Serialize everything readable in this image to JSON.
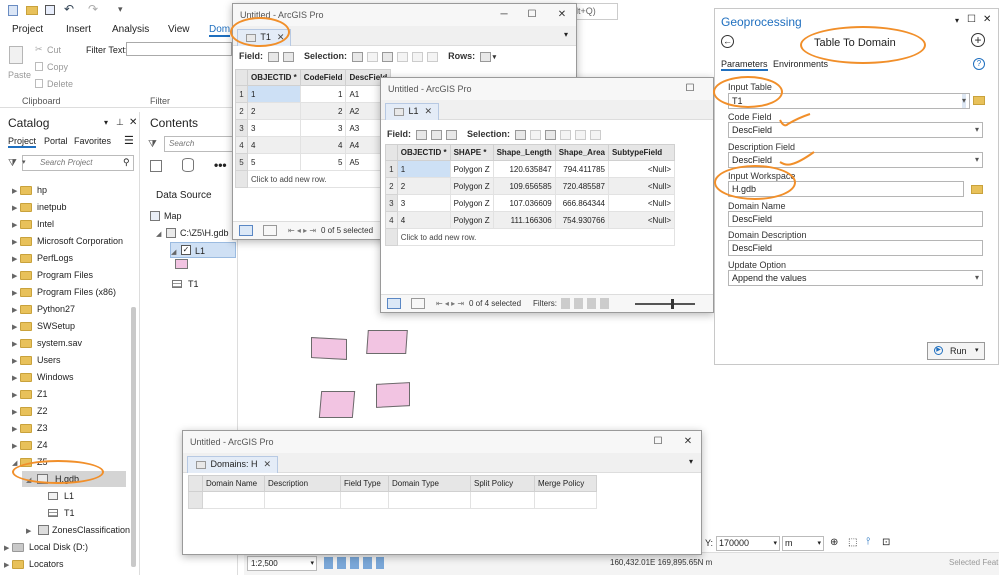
{
  "ribbon": {
    "tabs": [
      "Project",
      "Insert",
      "Analysis",
      "View",
      "Dom"
    ],
    "buttons": {
      "paste": "Paste",
      "cut": "Cut",
      "copy": "Copy",
      "delete": "Delete"
    },
    "filter_text_label": "Filter Text:",
    "groups": {
      "clipboard": "Clipboard",
      "filter": "Filter"
    },
    "search_hint": "Alt+Q)"
  },
  "catalog": {
    "title": "Catalog",
    "tabs": [
      "Project",
      "Portal",
      "Favorites"
    ],
    "search_placeholder": "Search Project",
    "items": [
      "hp",
      "inetpub",
      "Intel",
      "Microsoft Corporation",
      "PerfLogs",
      "Program Files",
      "Program Files (x86)",
      "Python27",
      "SWSetup",
      "system.sav",
      "Users",
      "Windows",
      "Z1",
      "Z2",
      "Z3",
      "Z4",
      "Z5"
    ],
    "gdb": "H.gdb",
    "gdb_children": [
      "L1",
      "T1"
    ],
    "zones": "ZonesClassification",
    "local_disk": "Local Disk (D:)",
    "locators": "Locators"
  },
  "contents": {
    "title": "Contents",
    "search_placeholder": "Search",
    "section": "Data Source",
    "map": "Map",
    "path": "C:\\Z5\\H.gdb",
    "layer": "L1",
    "table": "T1"
  },
  "t1_window": {
    "title": "Untitled - ArcGIS Pro",
    "tab": "T1",
    "field_label": "Field:",
    "selection_label": "Selection:",
    "rows_label": "Rows:",
    "columns": [
      "OBJECTID *",
      "CodeField",
      "DescField"
    ],
    "rows": [
      [
        "1",
        "1",
        "A1"
      ],
      [
        "2",
        "2",
        "A2"
      ],
      [
        "3",
        "3",
        "A3"
      ],
      [
        "4",
        "4",
        "A4"
      ],
      [
        "5",
        "5",
        "A5"
      ]
    ],
    "add_row": "Click to add new row.",
    "status": "0 of 5 selected"
  },
  "l1_window": {
    "title": "Untitled - ArcGIS Pro",
    "tab": "L1",
    "field_label": "Field:",
    "selection_label": "Selection:",
    "columns": [
      "OBJECTID *",
      "SHAPE *",
      "Shape_Length",
      "Shape_Area",
      "SubtypeField"
    ],
    "rows": [
      [
        "1",
        "Polygon Z",
        "120.635847",
        "794.411785",
        "<Null>"
      ],
      [
        "2",
        "Polygon Z",
        "109.656585",
        "720.485587",
        "<Null>"
      ],
      [
        "3",
        "Polygon Z",
        "107.036609",
        "666.864344",
        "<Null>"
      ],
      [
        "4",
        "Polygon Z",
        "111.166306",
        "754.930766",
        "<Null>"
      ]
    ],
    "add_row": "Click to add new row.",
    "status": "0 of 4 selected",
    "filters_label": "Filters:"
  },
  "domains_window": {
    "title": "Untitled - ArcGIS Pro",
    "tab": "Domains: H",
    "columns": [
      "Domain Name",
      "Description",
      "Field Type",
      "Domain Type",
      "Split Policy",
      "Merge Policy"
    ]
  },
  "geoprocessing": {
    "title": "Geoprocessing",
    "tool": "Table To Domain",
    "tabs": [
      "Parameters",
      "Environments"
    ],
    "fields": [
      {
        "label": "Input Table",
        "value": "T1"
      },
      {
        "label": "Code Field",
        "value": "DescField"
      },
      {
        "label": "Description Field",
        "value": "DescField"
      },
      {
        "label": "Input Workspace",
        "value": "H.gdb"
      },
      {
        "label": "Domain Name",
        "value": "DescField"
      },
      {
        "label": "Domain Description",
        "value": "DescField"
      },
      {
        "label": "Update Option",
        "value": "Append the values"
      }
    ],
    "run": "Run"
  },
  "map_status": {
    "scale": "1:2,500",
    "coords": "160,432.01E 169,895.65N m",
    "y_label": "Y:",
    "y_value": "170000",
    "unit": "m",
    "selected": "Selected Feat"
  },
  "colors": {
    "annotation": "#f18f2a",
    "polygon_fill": "#f2c4e2",
    "accent": "#1f6fbf"
  }
}
